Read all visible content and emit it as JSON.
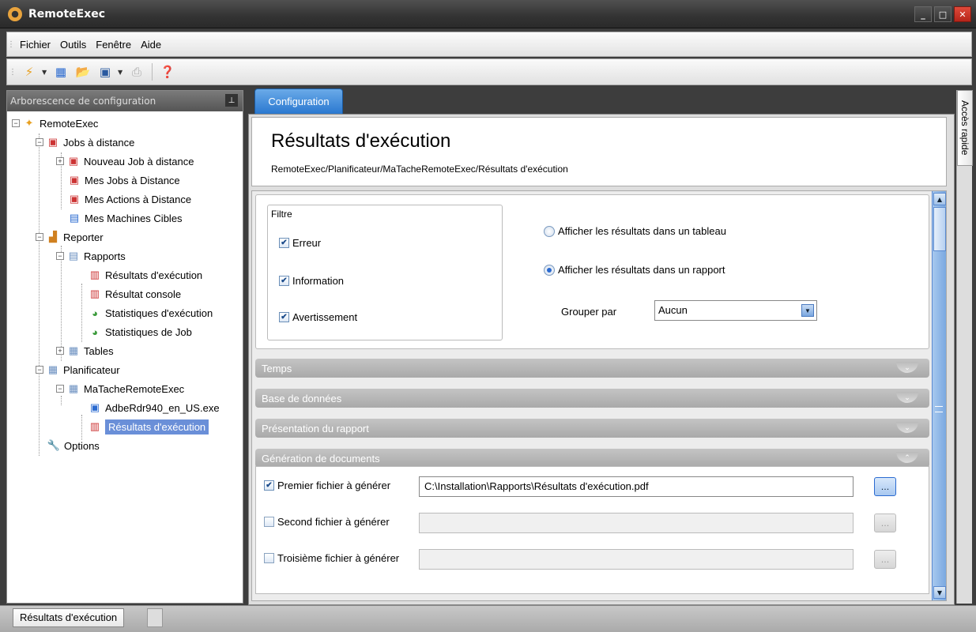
{
  "window": {
    "title": "RemoteExec"
  },
  "menu": {
    "items": [
      "Fichier",
      "Outils",
      "Fenêtre",
      "Aide"
    ]
  },
  "toolbar": {
    "icons": [
      "lightning-icon",
      "schedule-icon",
      "open-folder-icon",
      "save-icon",
      "print-icon",
      "help-icon"
    ]
  },
  "tree": {
    "header": "Arborescence de configuration",
    "nodes": [
      {
        "label": "RemoteExec"
      },
      {
        "label": "Jobs à distance"
      },
      {
        "label": "Nouveau Job à distance"
      },
      {
        "label": "Mes Jobs à Distance"
      },
      {
        "label": "Mes Actions à Distance"
      },
      {
        "label": "Mes Machines Cibles"
      },
      {
        "label": "Reporter"
      },
      {
        "label": "Rapports"
      },
      {
        "label": "Résultats d'exécution"
      },
      {
        "label": "Résultat console"
      },
      {
        "label": "Statistiques d'exécution"
      },
      {
        "label": "Statistiques de Job"
      },
      {
        "label": "Tables"
      },
      {
        "label": "Planificateur"
      },
      {
        "label": "MaTacheRemoteExec"
      },
      {
        "label": "AdbeRdr940_en_US.exe"
      },
      {
        "label": "Résultats d'exécution"
      },
      {
        "label": "Options"
      }
    ]
  },
  "tab": {
    "label": "Configuration"
  },
  "page": {
    "title": "Résultats d'exécution",
    "breadcrumb": "RemoteExec/Planificateur/MaTacheRemoteExec/Résultats d'exécution"
  },
  "filter": {
    "title": "Filtre",
    "error": "Erreur",
    "information": "Information",
    "warning": "Avertissement"
  },
  "display": {
    "table_option": "Afficher les résultats dans un tableau",
    "report_option": "Afficher les résultats dans un rapport",
    "group_label": "Grouper par",
    "group_value": "Aucun"
  },
  "sections": [
    "Temps",
    "Base de données",
    "Présentation du rapport",
    "Génération de documents"
  ],
  "documents": {
    "first_label": "Premier fichier à générer",
    "first_path": "C:\\Installation\\Rapports\\Résultats d'exécution.pdf",
    "second_label": "Second fichier à générer",
    "third_label": "Troisième fichier à générer",
    "browse": "..."
  },
  "quick_access": "Accès rapide",
  "status": {
    "tab": "Résultats d'exécution"
  }
}
